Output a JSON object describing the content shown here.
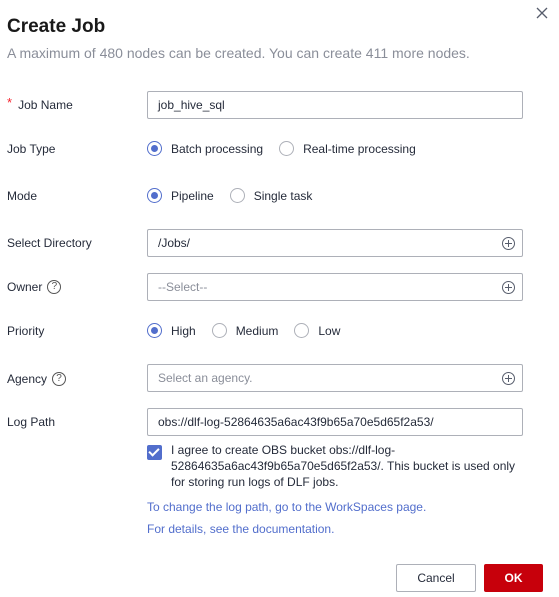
{
  "dialog": {
    "title": "Create Job",
    "subtitle": "A maximum of 480 nodes can be created. You can create 411 more nodes."
  },
  "form": {
    "job_name": {
      "label": "Job Name",
      "required_mark": "*",
      "value": "job_hive_sql"
    },
    "job_type": {
      "label": "Job Type",
      "options": [
        "Batch processing",
        "Real-time processing"
      ],
      "selected": "Batch processing"
    },
    "mode": {
      "label": "Mode",
      "options": [
        "Pipeline",
        "Single task"
      ],
      "selected": "Pipeline"
    },
    "directory": {
      "label": "Select Directory",
      "value": "/Jobs/"
    },
    "owner": {
      "label": "Owner",
      "help": "?",
      "placeholder": "--Select--"
    },
    "priority": {
      "label": "Priority",
      "options": [
        "High",
        "Medium",
        "Low"
      ],
      "selected": "High"
    },
    "agency": {
      "label": "Agency",
      "help": "?",
      "placeholder": "Select an agency."
    },
    "log_path": {
      "label": "Log Path",
      "value": "obs://dlf-log-52864635a6ac43f9b65a70e5d65f2a53/"
    },
    "agree": {
      "checked": true,
      "text": "I agree to create OBS bucket obs://dlf-log-52864635a6ac43f9b65a70e5d65f2a53/. This bucket is used only for storing run logs of DLF jobs."
    },
    "links": {
      "change_log_path": "To change the log path, go to the WorkSpaces page.",
      "documentation": "For details, see the documentation."
    }
  },
  "footer": {
    "cancel": "Cancel",
    "ok": "OK"
  },
  "colors": {
    "accent": "#526ecc",
    "primary_button": "#c7000b",
    "required": "#f5222d"
  }
}
